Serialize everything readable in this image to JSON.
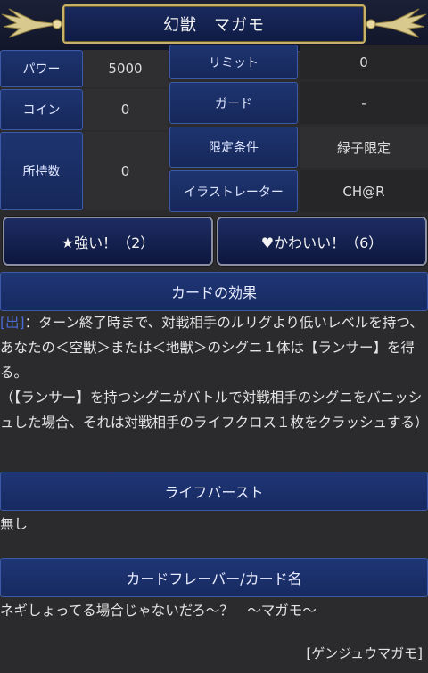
{
  "header": {
    "title": "幻獣　マガモ"
  },
  "stats": {
    "power_label": "パワー",
    "power_value": "5000",
    "limit_label": "リミット",
    "limit_value": "0",
    "coin_label": "コイン",
    "coin_value": "0",
    "guard_label": "ガード",
    "guard_value": "-",
    "owned_label": "所持数",
    "owned_value": "0",
    "condition_label": "限定条件",
    "condition_value": "緑子限定",
    "illustrator_label": "イラストレーター",
    "illustrator_value": "CH@R"
  },
  "votes": {
    "strong_label": "★強い！（2）",
    "cute_label": "♥かわいい！（6）"
  },
  "effect": {
    "heading": "カードの効果",
    "tag": "[出]",
    "text": "：ターン終了時まで、対戦相手のルリグより低いレベルを持つ、あなたの＜空獣＞または＜地獣＞のシグニ１体は【ランサー】を得る。\n（【ランサー】を持つシグニがバトルで対戦相手のシグニをバニッシュした場合、それは対戦相手のライフクロス１枚をクラッシュする）"
  },
  "life_burst": {
    "heading": "ライフバースト",
    "text": "無し"
  },
  "flavor": {
    "heading": "カードフレーバー/カード名",
    "text": "ネギしょってる場合じゃないだろ～？　～マガモ～",
    "reading": "[ゲンジュウマガモ]"
  },
  "colors": {
    "accent": "#1f3676",
    "border": "#3c5aa8",
    "gold": "#c9b06b",
    "tag": "#4c6bd6"
  }
}
